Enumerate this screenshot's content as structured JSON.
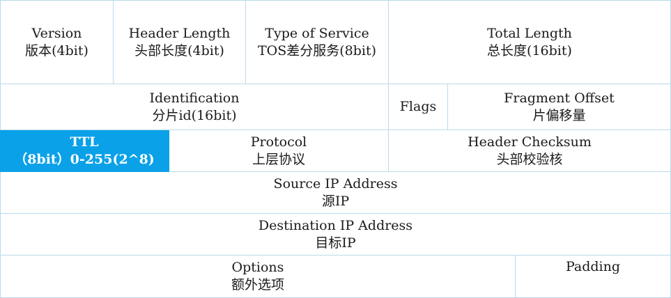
{
  "rows": {
    "row1": {
      "version": {
        "en": "Version",
        "zh": "版本(4bit)"
      },
      "header_length": {
        "en": "Header Length",
        "zh": "头部长度(4bit)"
      },
      "type_of_service": {
        "en": "Type of Service",
        "zh": "TOS差分服务(8bit)"
      },
      "total_length": {
        "en": "Total Length",
        "zh": "总长度(16bit)"
      }
    },
    "row2": {
      "identification": {
        "en": "Identification",
        "zh": "分片id(16bit)"
      },
      "flags": {
        "en": "Flags"
      },
      "fragment_offset": {
        "en": "Fragment Offset",
        "zh": "片偏移量"
      }
    },
    "row3": {
      "ttl": {
        "en": "TTL",
        "zh": "（8bit）0-255(2^8)"
      },
      "protocol": {
        "en": "Protocol",
        "zh": "上层协议"
      },
      "header_checksum": {
        "en": "Header Checksum",
        "zh": "头部校验核"
      }
    },
    "row4": {
      "source_ip": {
        "en": "Source IP Address",
        "zh": "源IP"
      }
    },
    "row5": {
      "destination_ip": {
        "en": "Destination IP Address",
        "zh": "目标IP"
      }
    },
    "row6": {
      "options": {
        "en": "Options",
        "zh": "额外选项"
      },
      "padding": {
        "en": "Padding"
      }
    }
  },
  "colors": {
    "highlight": "#0aa1e8",
    "border": "#b9dbec"
  }
}
